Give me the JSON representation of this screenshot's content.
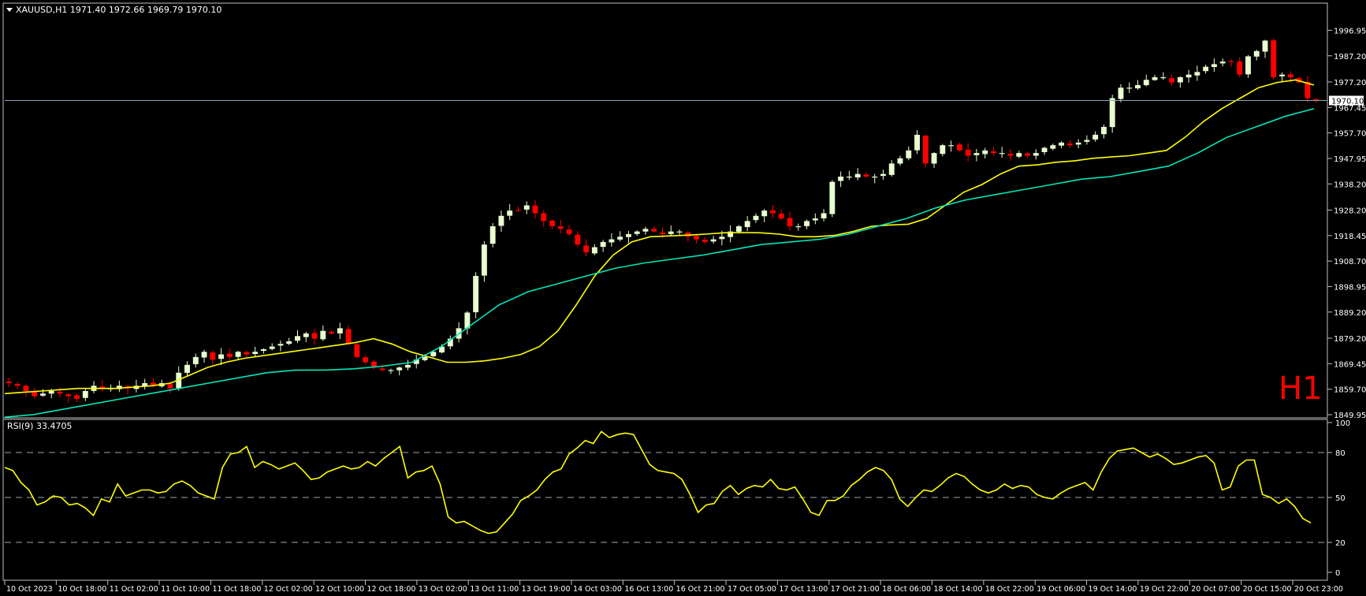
{
  "header": {
    "symbol_info": "XAUUSD,H1  1971.40 1972.66 1969.79 1970.10",
    "timeframe_badge": "H1"
  },
  "rsi_panel": {
    "label": "RSI(9) 33.4705"
  },
  "colors": {
    "background": "#000000",
    "frame": "#c0c0c0",
    "bull_candle": "#e8ffd0",
    "bear_candle": "#ff0000",
    "ma_fast": "#ffff00",
    "ma_slow": "#00e6b8",
    "rsi_line": "#ffff00",
    "level_line": "#6a7a8a",
    "badge": "#ff0000",
    "price_box": "#ffffff"
  },
  "chart_data": [
    {
      "type": "candlestick",
      "symbol": "XAUUSD",
      "timeframe": "H1",
      "last_price": 1970.1,
      "ohlc_last": {
        "open": 1971.4,
        "high": 1972.66,
        "low": 1969.79,
        "close": 1970.1
      },
      "ylim": [
        1849.95,
        2001.0
      ],
      "y_ticks": [
        "1996.95",
        "1987.20",
        "1977.20",
        "1967.45",
        "1957.70",
        "1947.95",
        "1938.20",
        "1928.20",
        "1918.45",
        "1908.70",
        "1898.95",
        "1889.20",
        "1879.20",
        "1869.45",
        "1859.70",
        "1849.95"
      ],
      "x_ticks": [
        "10 Oct 2023",
        "10 Oct 18:00",
        "11 Oct 02:00",
        "11 Oct 10:00",
        "11 Oct 18:00",
        "12 Oct 02:00",
        "12 Oct 10:00",
        "12 Oct 18:00",
        "13 Oct 02:00",
        "13 Oct 11:00",
        "13 Oct 19:00",
        "14 Oct 03:00",
        "16 Oct 13:00",
        "16 Oct 21:00",
        "17 Oct 05:00",
        "17 Oct 13:00",
        "17 Oct 21:00",
        "18 Oct 06:00",
        "18 Oct 14:00",
        "18 Oct 22:00",
        "19 Oct 06:00",
        "19 Oct 14:00",
        "19 Oct 22:00",
        "20 Oct 07:00",
        "20 Oct 15:00",
        "20 Oct 23:00"
      ],
      "close_anchors": [
        1862,
        1861,
        1859,
        1857,
        1858,
        1859,
        1858,
        1857,
        1856,
        1859,
        1861,
        1860,
        1860,
        1861,
        1860,
        1861,
        1862,
        1861,
        1862,
        1860,
        1866,
        1869,
        1872,
        1874,
        1871,
        1873,
        1872,
        1874,
        1873,
        1874,
        1875,
        1876,
        1877,
        1878,
        1880,
        1881,
        1879,
        1882,
        1881,
        1883,
        1877,
        1872,
        1870,
        1868,
        1867,
        1867,
        1868,
        1869,
        1871,
        1872,
        1874,
        1876,
        1879,
        1883,
        1889,
        1903,
        1915,
        1922,
        1926,
        1928,
        1928,
        1930,
        1927,
        1924,
        1922,
        1921,
        1919,
        1915,
        1912,
        1914,
        1916,
        1917,
        1918,
        1919,
        1920,
        1921,
        1920,
        1919,
        1920,
        1920,
        1918,
        1917,
        1916,
        1917,
        1918,
        1920,
        1922,
        1924,
        1926,
        1928,
        1927,
        1925,
        1922,
        1922,
        1924,
        1925,
        1927,
        1939,
        1941,
        1941,
        1942,
        1941,
        1941,
        1942,
        1946,
        1948,
        1951,
        1957,
        1946,
        1950,
        1953,
        1953,
        1951,
        1949,
        1950,
        1951,
        1950,
        1950,
        1949,
        1950,
        1949,
        1950,
        1952,
        1953,
        1954,
        1953,
        1954,
        1955,
        1957,
        1960,
        1971,
        1975,
        1975,
        1976,
        1978,
        1979,
        1979,
        1977,
        1979,
        1980,
        1981,
        1983,
        1984,
        1985,
        1985,
        1980,
        1987,
        1989,
        1993,
        1979,
        1980,
        1979,
        1977,
        1971,
        1970
      ],
      "series": [
        {
          "name": "",
          "type": "ma",
          "role": "fast",
          "values": [
            1858,
            1858.5,
            1859,
            1859.5,
            1860,
            1860,
            1860,
            1860.5,
            1861,
            1862,
            1865,
            1868,
            1870,
            1871.5,
            1872.5,
            1873.5,
            1874.5,
            1875.5,
            1876.5,
            1877.5,
            1879,
            1877,
            1874,
            1872,
            1870,
            1870,
            1870.5,
            1871.5,
            1873,
            1876,
            1882,
            1892,
            1903,
            1911,
            1916,
            1918,
            1918.3,
            1918.6,
            1919,
            1919.5,
            1919.6,
            1919.5,
            1919,
            1918,
            1918,
            1918.5,
            1920,
            1922,
            1922.5,
            1922.8,
            1925,
            1930,
            1935,
            1938,
            1942,
            1945,
            1945.5,
            1946.5,
            1947,
            1948,
            1948.5,
            1949,
            1950,
            1951,
            1956,
            1962,
            1967,
            1971,
            1975,
            1977,
            1978,
            1976
          ]
        },
        {
          "name": "",
          "type": "ma",
          "role": "slow",
          "values": [
            1849,
            1850,
            1852,
            1854,
            1856,
            1858,
            1860,
            1862,
            1864,
            1866,
            1867,
            1867,
            1867.5,
            1868.5,
            1870,
            1876,
            1884,
            1892,
            1897,
            1900,
            1903,
            1906,
            1908,
            1909.5,
            1911,
            1913,
            1915,
            1916,
            1917,
            1919,
            1922,
            1925,
            1929,
            1932,
            1934,
            1936,
            1938,
            1940,
            1941,
            1943,
            1945,
            1950,
            1956,
            1960,
            1964,
            1967
          ]
        }
      ]
    },
    {
      "type": "line",
      "title": "RSI(9) 33.4705",
      "indicator": "RSI",
      "period": 9,
      "last_value": 33.4705,
      "ylim": [
        0,
        100
      ],
      "y_ticks": [
        0,
        20,
        50,
        80,
        100
      ],
      "levels": [
        20,
        50,
        80
      ],
      "values": [
        70,
        68,
        60,
        55,
        45,
        47,
        51,
        50,
        45,
        46,
        43,
        38,
        49,
        47,
        59,
        51,
        53,
        55,
        55,
        53,
        54,
        59,
        61,
        58,
        53,
        51,
        49,
        70,
        79,
        80,
        84,
        70,
        74,
        72,
        69,
        71,
        73,
        68,
        62,
        63,
        67,
        69,
        71,
        69,
        70,
        74,
        71,
        76,
        80,
        84,
        63,
        67,
        68,
        71,
        59,
        37,
        33,
        34,
        31,
        28,
        26,
        27,
        33,
        39,
        48,
        51,
        55,
        62,
        67,
        69,
        79,
        83,
        88,
        86,
        94,
        90,
        92,
        93,
        92,
        82,
        72,
        68,
        67,
        66,
        62,
        52,
        40,
        45,
        46,
        54,
        58,
        52,
        56,
        58,
        57,
        62,
        56,
        55,
        57,
        49,
        40,
        38,
        48,
        48,
        51,
        58,
        62,
        67,
        70,
        68,
        62,
        49,
        44,
        50,
        55,
        54,
        58,
        63,
        66,
        64,
        59,
        55,
        53,
        55,
        59,
        56,
        58,
        57,
        52,
        50,
        49,
        53,
        56,
        58,
        60,
        55,
        67,
        76,
        81,
        82,
        83,
        80,
        77,
        79,
        76,
        72,
        73,
        75,
        77,
        78,
        73,
        55,
        57,
        71,
        75,
        75,
        52,
        50,
        46,
        49,
        44,
        36,
        33
      ]
    }
  ]
}
